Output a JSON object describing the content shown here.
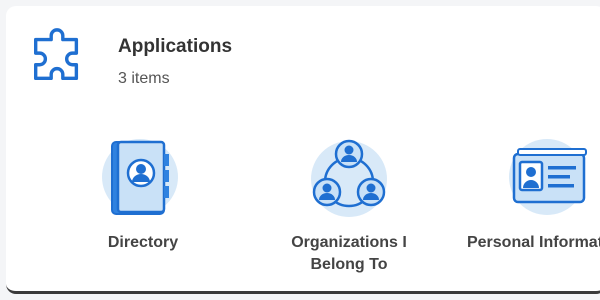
{
  "card": {
    "title": "Applications",
    "subtitle": "3 items",
    "icon": "puzzle-piece-icon"
  },
  "apps": [
    {
      "label": "Directory",
      "icon": "address-book-icon"
    },
    {
      "label": "Organizations I Belong To",
      "icon": "org-network-icon"
    },
    {
      "label": "Personal Information",
      "icon": "id-card-icon"
    }
  ],
  "colors": {
    "accent": "#1f6fd1",
    "icon_fill": "#c9e1f7",
    "circle_bg": "#d8e9f8"
  }
}
